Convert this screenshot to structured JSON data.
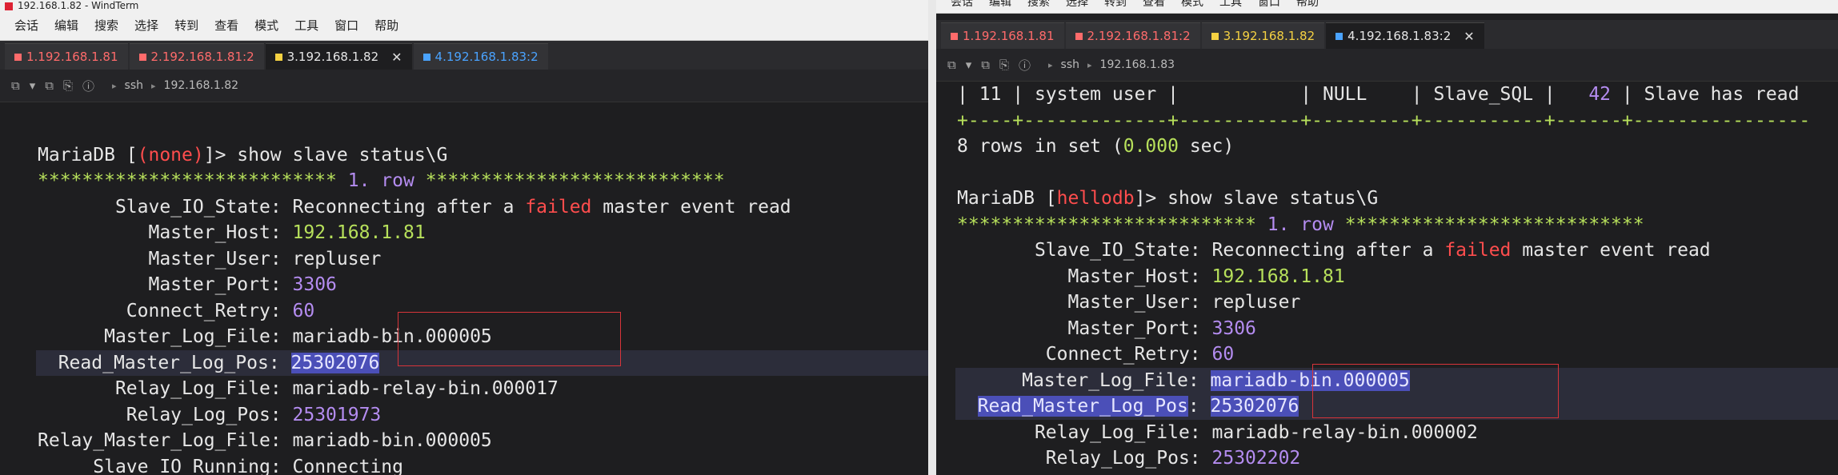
{
  "left": {
    "title": "192.168.1.82 - WindTerm",
    "menu": [
      "会话",
      "编辑",
      "搜索",
      "选择",
      "转到",
      "查看",
      "模式",
      "工具",
      "窗口",
      "帮助"
    ],
    "tabs": [
      {
        "label": "1.192.168.1.81",
        "color": "#ff6b6b",
        "active": false
      },
      {
        "label": "2.192.168.1.81:2",
        "color": "#ff6b6b",
        "active": false
      },
      {
        "label": "3.192.168.1.82",
        "color": "#f5d142",
        "active": true
      },
      {
        "label": "4.192.168.1.83:2",
        "color": "#4aa3ff",
        "active": false
      }
    ],
    "breadcrumb": {
      "proto": "ssh",
      "host": "192.168.1.82"
    },
    "prompt": {
      "prefix": "MariaDB [",
      "db": "(none)",
      "suffix": "]> ",
      "cmd": "show slave status\\G"
    },
    "row_banner": {
      "stars_left": "***************************",
      "label": "1. row",
      "stars_right": "***************************"
    },
    "fields": [
      {
        "name": "Slave_IO_State",
        "value": "Reconnecting after a failed master event read"
      },
      {
        "name": "Master_Host",
        "value": "192.168.1.81"
      },
      {
        "name": "Master_User",
        "value": "repluser"
      },
      {
        "name": "Master_Port",
        "value": "3306"
      },
      {
        "name": "Connect_Retry",
        "value": "60"
      },
      {
        "name": "Master_Log_File",
        "value": "mariadb-bin.000005"
      },
      {
        "name": "Read_Master_Log_Pos",
        "value": "25302076"
      },
      {
        "name": "Relay_Log_File",
        "value": "mariadb-relay-bin.000017"
      },
      {
        "name": "Relay_Log_Pos",
        "value": "25301973"
      },
      {
        "name": "Relay_Master_Log_File",
        "value": "mariadb-bin.000005"
      },
      {
        "name": "Slave_IO_Running",
        "value": "Connecting"
      }
    ]
  },
  "right": {
    "menu": [
      "会话",
      "编辑",
      "搜索",
      "选择",
      "转到",
      "查看",
      "模式",
      "工具",
      "窗口",
      "帮助"
    ],
    "tabs": [
      {
        "label": "1.192.168.1.81",
        "color": "#ff6b6b",
        "active": false
      },
      {
        "label": "2.192.168.1.81:2",
        "color": "#ff6b6b",
        "active": false
      },
      {
        "label": "3.192.168.1.82",
        "color": "#f5d142",
        "active": false
      },
      {
        "label": "4.192.168.1.83:2",
        "color": "#4aa3ff",
        "active": true
      }
    ],
    "breadcrumb": {
      "proto": "ssh",
      "host": "192.168.1.83"
    },
    "table_row": {
      "c1": "| 11 ",
      "c2": "| system user |",
      "c3": "           | NULL    ",
      "c4": "| Slave_SQL |",
      "c5": "   42 ",
      "c6": "| Slave has read"
    },
    "table_sep": "+----+-------------+-----------+---------+-----------+------+----------------",
    "rows_info": {
      "pre": "8 rows in set (",
      "time": "0.000",
      "post": " sec)"
    },
    "prompt": {
      "prefix": "MariaDB [",
      "db": "hellodb",
      "suffix": "]> ",
      "cmd": "show slave status\\G"
    },
    "row_banner": {
      "stars_left": "***************************",
      "label": "1. row",
      "stars_right": "***************************"
    },
    "fields": [
      {
        "name": "Slave_IO_State",
        "value": "Reconnecting after a failed master event read"
      },
      {
        "name": "Master_Host",
        "value": "192.168.1.81"
      },
      {
        "name": "Master_User",
        "value": "repluser"
      },
      {
        "name": "Master_Port",
        "value": "3306"
      },
      {
        "name": "Connect_Retry",
        "value": "60"
      },
      {
        "name": "Master_Log_File",
        "value": "mariadb-bin.000005"
      },
      {
        "name": "Read_Master_Log_Pos",
        "value": "25302076"
      },
      {
        "name": "Relay_Log_File",
        "value": "mariadb-relay-bin.000002"
      },
      {
        "name": "Relay_Log_Pos",
        "value": "25302202"
      }
    ]
  },
  "colors": {
    "green": "#b7e05b",
    "purple": "#b48cf0",
    "red": "#ff4d4d",
    "highlight": "#4b4fb8",
    "box": "#d8343a"
  }
}
